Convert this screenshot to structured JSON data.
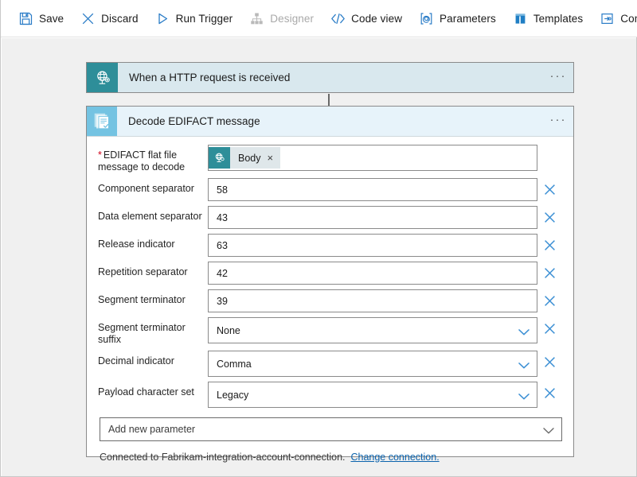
{
  "toolbar": {
    "items": [
      {
        "label": "Save",
        "icon": "save-icon",
        "disabled": false
      },
      {
        "label": "Discard",
        "icon": "discard-x-icon",
        "disabled": false
      },
      {
        "label": "Run Trigger",
        "icon": "play-triangle-icon",
        "disabled": false
      },
      {
        "label": "Designer",
        "icon": "designer-hierarchy-icon",
        "disabled": true
      },
      {
        "label": "Code view",
        "icon": "code-brackets-icon",
        "disabled": false
      },
      {
        "label": "Parameters",
        "icon": "at-sign-bracket-icon",
        "disabled": false
      },
      {
        "label": "Templates",
        "icon": "templates-grid-icon",
        "disabled": false
      },
      {
        "label": "Connectors",
        "icon": "connectors-arrow-icon",
        "disabled": false
      }
    ],
    "help_label": "?"
  },
  "trigger_card": {
    "title": "When a HTTP request is received",
    "icon": "http-globe-icon",
    "menu_label": "···",
    "icon_color": "#2e8e99",
    "body_color": "#d9e8ee"
  },
  "connector": {
    "icon": "down-arrow-icon"
  },
  "action_card": {
    "title": "Decode EDIFACT message",
    "icon": "edifact-document-icon",
    "menu_label": "···",
    "icon_color": "#74c3e2",
    "header_color": "#e7f3fa",
    "parameters": [
      {
        "label": "EDIFACT flat file message to decode",
        "required": true,
        "type": "token",
        "token": {
          "label": "Body",
          "icon": "http-globe-icon",
          "remove_label": "×"
        },
        "deletable": false
      },
      {
        "label": "Component separator",
        "required": false,
        "type": "text",
        "value": "58",
        "deletable": true
      },
      {
        "label": "Data element separator",
        "required": false,
        "type": "text",
        "value": "43",
        "deletable": true
      },
      {
        "label": "Release indicator",
        "required": false,
        "type": "text",
        "value": "63",
        "deletable": true
      },
      {
        "label": "Repetition separator",
        "required": false,
        "type": "text",
        "value": "42",
        "deletable": true
      },
      {
        "label": "Segment terminator",
        "required": false,
        "type": "text",
        "value": "39",
        "deletable": true
      },
      {
        "label": "Segment terminator suffix",
        "required": false,
        "type": "select",
        "value": "None",
        "deletable": true
      },
      {
        "label": "Decimal indicator",
        "required": false,
        "type": "select",
        "value": "Comma",
        "deletable": true
      },
      {
        "label": "Payload character set",
        "required": false,
        "type": "select",
        "value": "Legacy",
        "deletable": true
      }
    ],
    "add_parameter_label": "Add new parameter",
    "footer": {
      "text": "Connected to Fabrikam-integration-account-connection.",
      "link": "Change connection."
    }
  },
  "colors": {
    "accent_blue": "#3b8fd4",
    "link_blue": "#0b63ad",
    "required_red": "#d0021b",
    "canvas_gray": "#f0f0f0"
  }
}
